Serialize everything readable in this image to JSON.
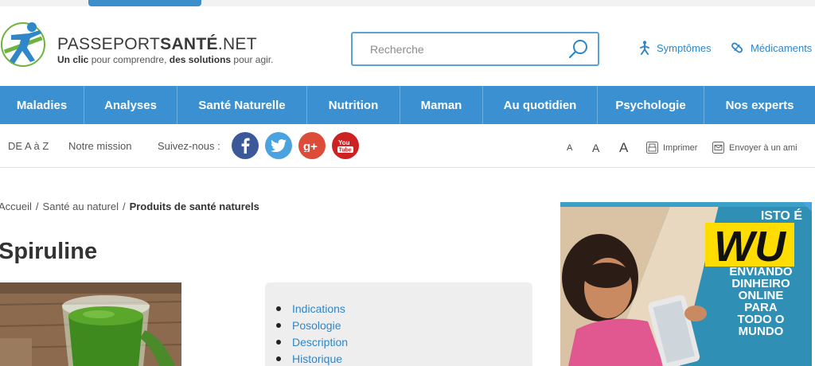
{
  "header": {
    "logo_name_light": "PASSEPORT",
    "logo_name_bold": "SANTÉ",
    "logo_name_suffix": ".NET",
    "tagline_1": "Un clic",
    "tagline_2": " pour comprendre, ",
    "tagline_3": "des solutions",
    "tagline_4": " pour agir.",
    "search_placeholder": "Recherche",
    "links": [
      {
        "label": "Symptômes",
        "icon": "walking-person-icon"
      },
      {
        "label": "Médicaments",
        "icon": "pill-icon"
      }
    ]
  },
  "nav": {
    "items": [
      "Maladies",
      "Analyses",
      "Santé Naturelle",
      "Nutrition",
      "Maman",
      "Au quotidien",
      "Psychologie",
      "Nos experts"
    ]
  },
  "subbar": {
    "az_label": "DE A à Z",
    "mission_label": "Notre mission",
    "follow_label": "Suivez-nous :",
    "social": [
      {
        "name": "facebook",
        "glyph": "f",
        "color": "#3b5998"
      },
      {
        "name": "twitter",
        "glyph": "t",
        "color": "#4aa3df"
      },
      {
        "name": "google-plus",
        "glyph": "g+",
        "color": "#dd4b39"
      },
      {
        "name": "youtube",
        "glyph": "You",
        "color": "#cc2222"
      }
    ],
    "font_sizes": [
      "A",
      "A",
      "A"
    ],
    "print_label": "Imprimer",
    "email_label": "Envoyer à un ami"
  },
  "breadcrumb": {
    "items": [
      "Accueil",
      "Santé au naturel"
    ],
    "current": "Produits de santé naturels"
  },
  "page_title": "Spiruline",
  "toc": {
    "items": [
      "Indications",
      "Posologie",
      "Description",
      "Historique"
    ]
  },
  "ad": {
    "headline": "ISTO É",
    "brand": "WU",
    "lines": [
      "ENVIANDO",
      "DINHEIRO",
      "ONLINE",
      "PARA",
      "TODO O",
      "MUNDO"
    ]
  },
  "colors": {
    "primary_blue": "#3a90d0",
    "link_blue": "#2f86c8",
    "logo_green": "#6db33f",
    "wu_yellow": "#ffdd00"
  }
}
